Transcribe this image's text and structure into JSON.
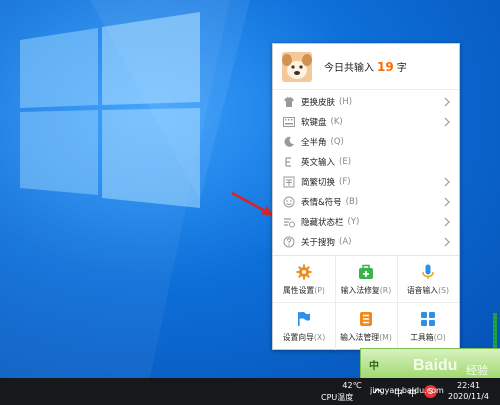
{
  "menu": {
    "header": {
      "prefix": "今日共输入",
      "count": "19",
      "suffix": "字"
    },
    "items": [
      {
        "label": "更换皮肤",
        "shortcut": "(H)",
        "icon": "shirt-icon",
        "submenu": true
      },
      {
        "label": "软键盘",
        "shortcut": "(K)",
        "icon": "keyboard-icon",
        "submenu": true
      },
      {
        "label": "全半角",
        "shortcut": "(Q)",
        "icon": "moon-icon",
        "submenu": false
      },
      {
        "label": "英文输入",
        "shortcut": "(E)",
        "icon": "english-icon",
        "submenu": false
      },
      {
        "label": "简繁切换",
        "shortcut": "(F)",
        "icon": "simplified-traditional-icon",
        "submenu": true
      },
      {
        "label": "表情&符号",
        "shortcut": "(B)",
        "icon": "emoji-icon",
        "submenu": true
      },
      {
        "label": "隐藏状态栏",
        "shortcut": "(Y)",
        "icon": "hide-statusbar-icon",
        "submenu": true
      },
      {
        "label": "关于搜狗",
        "shortcut": "(A)",
        "icon": "question-icon",
        "submenu": true
      }
    ],
    "grid": [
      {
        "label": "属性设置",
        "shortcut": "(P)",
        "icon": "gear-icon",
        "color": "#f08a1c"
      },
      {
        "label": "输入法修复",
        "shortcut": "(R)",
        "icon": "toolbox-plus-icon",
        "color": "#3bb34a"
      },
      {
        "label": "语音输入",
        "shortcut": "(S)",
        "icon": "microphone-icon",
        "color": "#2d8fe6"
      },
      {
        "label": "设置向导",
        "shortcut": "(X)",
        "icon": "flag-icon",
        "color": "#2d8fe6"
      },
      {
        "label": "输入法管理",
        "shortcut": "(M)",
        "icon": "manage-icon",
        "color": "#f08a1c"
      },
      {
        "label": "工具箱",
        "shortcut": "(O)",
        "icon": "apps-grid-icon",
        "color": "#2d8fe6"
      }
    ]
  },
  "taskbar": {
    "cpu_temp": "42℃",
    "cpu_label": "CPU温度",
    "ime_zh_1": "中",
    "ime_zh_2": "中",
    "sogou_glyph": "S",
    "time": "22:41",
    "date": "2020/11/4"
  },
  "ime_bar": {
    "zh": "中"
  },
  "watermark": {
    "logo": "Baidu",
    "experience": "经验",
    "url": "jingyan.baidu.com"
  },
  "colors": {
    "accent": "#ff6a00",
    "desktop": "#0a63c9",
    "taskbar": "#16181c",
    "annotation_arrow": "#e02020"
  }
}
